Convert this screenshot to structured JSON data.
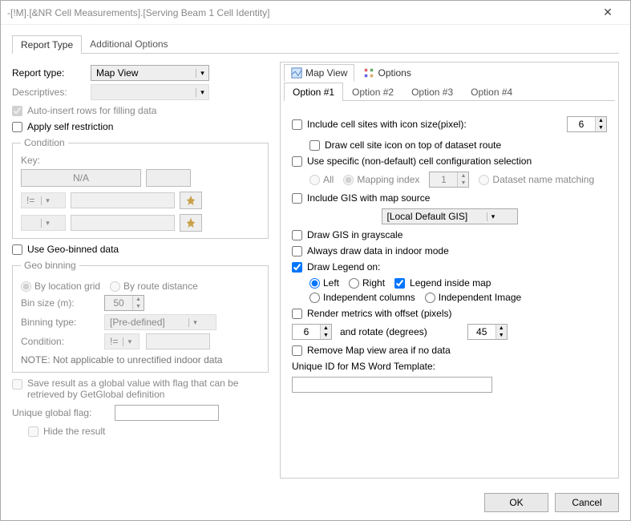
{
  "window": {
    "title": "-[!M].[&NR Cell Measurements].[Serving Beam 1 Cell Identity]"
  },
  "main_tabs": [
    "Report Type",
    "Additional Options"
  ],
  "left": {
    "report_type_label": "Report type:",
    "report_type_value": "Map View",
    "descriptives_label": "Descriptives:",
    "auto_insert": "Auto-insert rows for filling data",
    "apply_self": "Apply self restriction",
    "condition": {
      "legend": "Condition",
      "key_label": "Key:",
      "key_btn": "N/A",
      "op1": "!=",
      "op2": ""
    },
    "use_geo": "Use Geo-binned data",
    "geo": {
      "legend": "Geo binning",
      "by_loc": "By location grid",
      "by_route": "By route distance",
      "bin_size_label": "Bin size (m):",
      "bin_size": "50",
      "binning_type_label": "Binning type:",
      "binning_type": "[Pre-defined]",
      "cond_label": "Condition:",
      "cond_op": "!=",
      "note": "NOTE: Not applicable to unrectified indoor data"
    },
    "save_global": "Save result as a global value with flag that can be retrieved by GetGlobal definition",
    "unique_flag_label": "Unique global flag:",
    "hide_result": "Hide the result"
  },
  "right": {
    "view_tabs": {
      "map": "Map View",
      "options": "Options"
    },
    "option_tabs": [
      "Option #1",
      "Option #2",
      "Option #3",
      "Option #4"
    ],
    "include_cells": "Include cell sites with icon size(pixel):",
    "icon_size": "6",
    "draw_cell_icon": "Draw cell site icon on top of dataset route",
    "use_specific": "Use specific (non-default) cell configuration selection",
    "cfg": {
      "all": "All",
      "mapping": "Mapping index",
      "mapping_val": "1",
      "dataset": "Dataset name matching"
    },
    "include_gis": "Include GIS with map source",
    "gis_source": "[Local Default GIS]",
    "draw_gray": "Draw GIS in grayscale",
    "always_indoor": "Always draw data in indoor mode",
    "draw_legend": "Draw Legend on:",
    "legend": {
      "left": "Left",
      "right": "Right",
      "inside": "Legend inside map",
      "indep_cols": "Independent columns",
      "indep_img": "Independent Image"
    },
    "render_offset": "Render metrics with offset (pixels)",
    "offset_val": "6",
    "rotate_label": "and rotate (degrees)",
    "rotate_val": "45",
    "remove_map": "Remove Map view area if no data",
    "unique_id_label": "Unique ID for MS Word Template:"
  },
  "footer": {
    "ok": "OK",
    "cancel": "Cancel"
  }
}
